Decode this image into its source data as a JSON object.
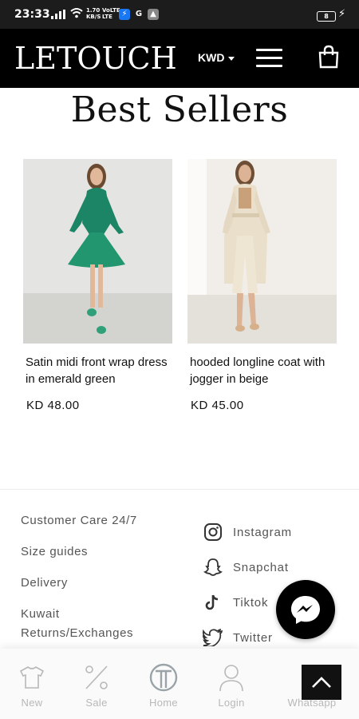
{
  "status_bar": {
    "time": "23:33",
    "net_line1": "1.70",
    "net_line2": "KB/S",
    "net2_line1": "VoLTE",
    "net2_line2": "LTE",
    "battery": "8",
    "apps": [
      "messenger-icon",
      "google-icon",
      "gallery-icon"
    ]
  },
  "header": {
    "logo": "LETOUCH",
    "currency": "KWD",
    "icons": [
      "menu-icon",
      "shopping-bag-icon"
    ]
  },
  "section_title": "Best Sellers",
  "products": [
    {
      "name": "Satin midi front wrap dress in emerald green",
      "price": "KD 48.00",
      "color": "#1f8a6a"
    },
    {
      "name": "hooded longline coat with jogger in beige",
      "price": "KD 45.00",
      "color": "#e9dcc6"
    }
  ],
  "footer": {
    "links": [
      "Customer Care 24/7",
      "Size guides",
      "Delivery",
      "Kuwait Returns/Exchanges"
    ],
    "social": [
      {
        "label": "Instagram",
        "icon": "instagram-icon"
      },
      {
        "label": "Snapchat",
        "icon": "snapchat-icon"
      },
      {
        "label": "Tiktok",
        "icon": "tiktok-icon"
      },
      {
        "label": "Twitter",
        "icon": "twitter-icon"
      }
    ]
  },
  "bottom_nav": [
    {
      "label": "New",
      "icon": "tshirt-icon"
    },
    {
      "label": "Sale",
      "icon": "percent-icon"
    },
    {
      "label": "Home",
      "icon": "home-logo-icon"
    },
    {
      "label": "Login",
      "icon": "user-icon"
    },
    {
      "label": "Whatsapp",
      "icon": "whatsapp-icon"
    }
  ],
  "colors": {
    "header_bg": "#000000",
    "text_muted": "#555555",
    "nav_inactive": "#b8b8b8"
  }
}
